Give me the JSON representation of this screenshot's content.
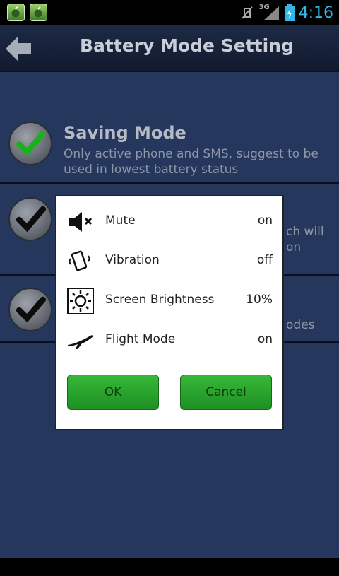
{
  "status_bar": {
    "network": "3G",
    "time": "4:16"
  },
  "title_bar": {
    "title": "Battery Mode Setting"
  },
  "modes": [
    {
      "title": "Saving Mode",
      "description": [
        "Only active phone and SMS, suggest to be",
        "used in lowest battery status"
      ],
      "checked": true
    },
    {
      "title": "",
      "description": [
        "ch will",
        "on"
      ],
      "checked": false
    },
    {
      "title": "",
      "description": [
        "odes"
      ],
      "checked": false
    }
  ],
  "dialog": {
    "rows": [
      {
        "icon": "mute-icon",
        "label": "Mute",
        "value": "on"
      },
      {
        "icon": "vibration-icon",
        "label": "Vibration",
        "value": "off"
      },
      {
        "icon": "brightness-icon",
        "label": "Screen Brightness",
        "value": "10%"
      },
      {
        "icon": "airplane-icon",
        "label": "Flight Mode",
        "value": "on"
      }
    ],
    "ok_label": "OK",
    "cancel_label": "Cancel"
  },
  "colors": {
    "accent_green": "#2aa32c",
    "background": "#26375e",
    "time_blue": "#33b5e5"
  }
}
